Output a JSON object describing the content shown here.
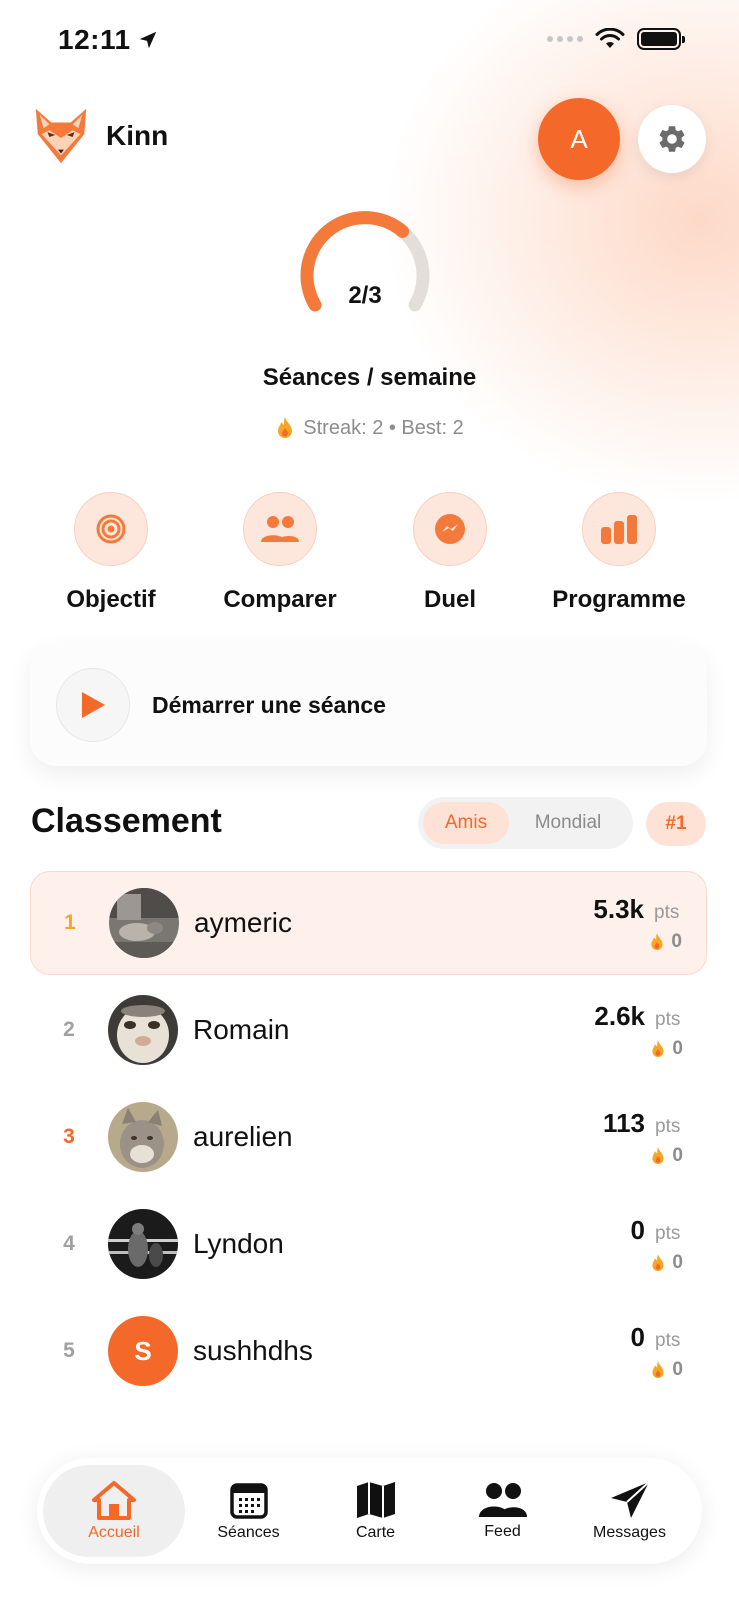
{
  "status_bar": {
    "time": "12:11"
  },
  "header": {
    "brand": "Kinn",
    "avatar_initial": "A"
  },
  "weekly_goal": {
    "value_text": "2/3",
    "progress": 0.667,
    "title": "Séances / semaine",
    "streak_text": "Streak: 2 • Best: 2"
  },
  "quick_actions": [
    {
      "label": "Objectif",
      "icon": "target-icon"
    },
    {
      "label": "Comparer",
      "icon": "people-icon"
    },
    {
      "label": "Duel",
      "icon": "messenger-icon"
    },
    {
      "label": "Programme",
      "icon": "bars-icon"
    }
  ],
  "start_session": {
    "label": "Démarrer une séance"
  },
  "leaderboard": {
    "title": "Classement",
    "tabs": [
      "Amis",
      "Mondial"
    ],
    "active_tab": "Amis",
    "my_rank": "#1",
    "rows": [
      {
        "rank": "1",
        "name": "aymeric",
        "score": "5.3k",
        "unit": "pts",
        "streak": "0",
        "avatar": "photo"
      },
      {
        "rank": "2",
        "name": "Romain",
        "score": "2.6k",
        "unit": "pts",
        "streak": "0",
        "avatar": "photo"
      },
      {
        "rank": "3",
        "name": "aurelien",
        "score": "113",
        "unit": "pts",
        "streak": "0",
        "avatar": "photo"
      },
      {
        "rank": "4",
        "name": "Lyndon",
        "score": "0",
        "unit": "pts",
        "streak": "0",
        "avatar": "photo"
      },
      {
        "rank": "5",
        "name": "sushhdhs",
        "score": "0",
        "unit": "pts",
        "streak": "0",
        "avatar": "initial",
        "initial": "S"
      }
    ]
  },
  "tabbar": [
    {
      "label": "Accueil",
      "icon": "home-icon",
      "active": true
    },
    {
      "label": "Séances",
      "icon": "calendar-icon",
      "active": false
    },
    {
      "label": "Carte",
      "icon": "map-icon",
      "active": false
    },
    {
      "label": "Feed",
      "icon": "people-icon",
      "active": false
    },
    {
      "label": "Messages",
      "icon": "send-icon",
      "active": false
    }
  ],
  "colors": {
    "accent": "#f4692a",
    "accent_light": "#fde2d5",
    "gold": "#f2a531"
  }
}
